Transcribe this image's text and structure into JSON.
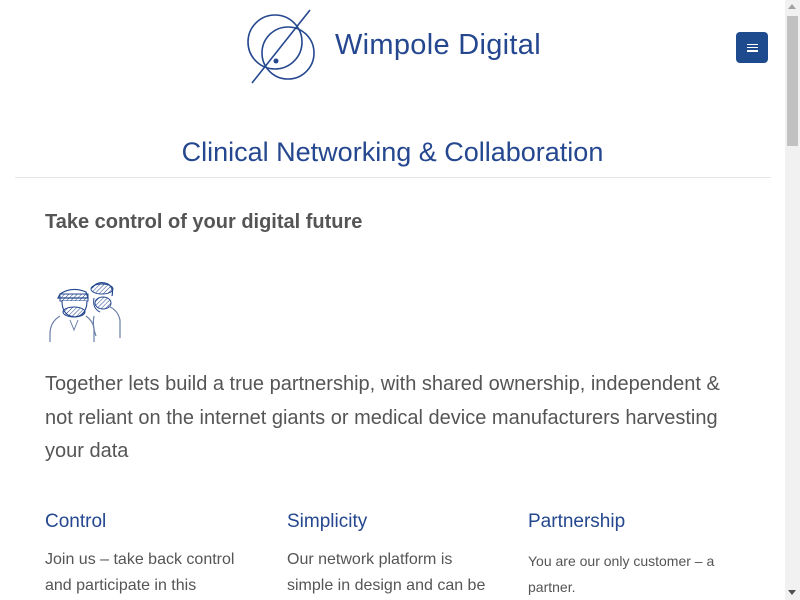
{
  "header": {
    "brand_name": "Wimpole Digital",
    "menu_icon": "hamburger-menu-icon",
    "accent_color": "#24478f",
    "button_color": "#1e4a8e"
  },
  "hero": {
    "title": "Clinical Networking & Collaboration"
  },
  "intro": {
    "heading": "Take control of your digital future",
    "illustration_icon": "clinicians-illustration-icon",
    "lead": "Together lets build a true partnership, with shared ownership, independent & not reliant on the internet giants or medical device manufacturers harvesting your data"
  },
  "columns": [
    {
      "title": "Control",
      "text": "Join us – take back control and participate in this"
    },
    {
      "title": "Simplicity",
      "text": "Our network platform is simple in design and can be"
    },
    {
      "title": "Partnership",
      "text": "You are our only customer – a partner."
    }
  ]
}
